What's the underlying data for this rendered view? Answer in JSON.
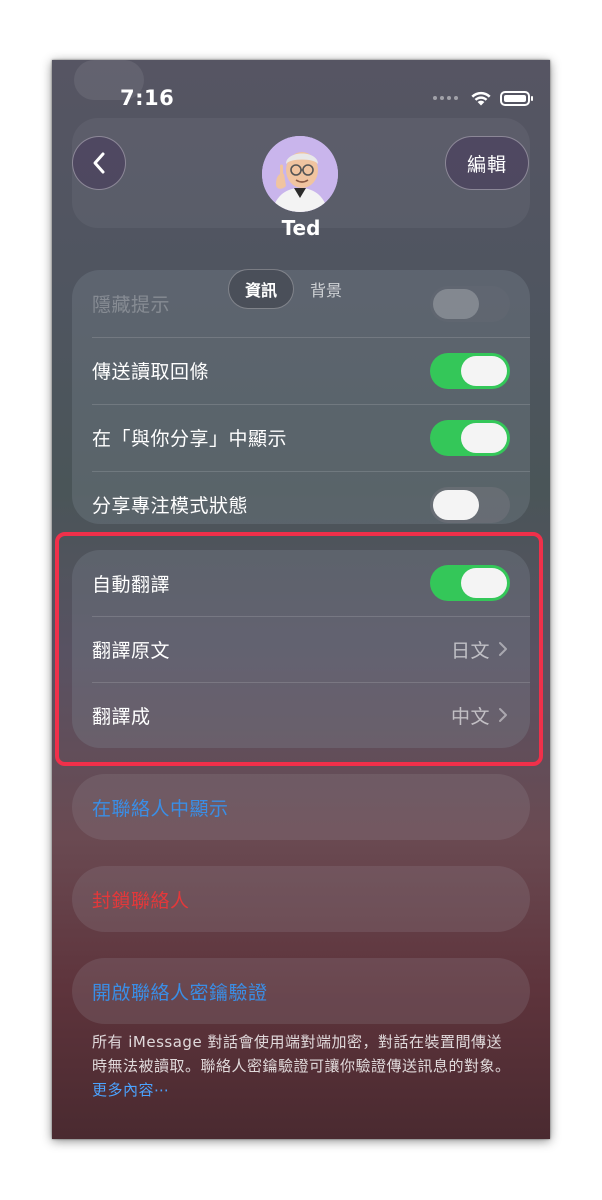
{
  "status_bar": {
    "time": "7:16"
  },
  "header": {
    "contact_name": "Ted",
    "edit_label": "編輯"
  },
  "tabs": [
    {
      "label": "資訊",
      "active": true
    },
    {
      "label": "背景",
      "active": false
    }
  ],
  "partial_row_behind_tabs": {
    "label": "隱藏提示",
    "toggle_on": false
  },
  "privacy_section": {
    "rows": [
      {
        "label": "傳送讀取回條",
        "toggle_on": true
      },
      {
        "label": "在「與你分享」中顯示",
        "toggle_on": true
      },
      {
        "label": "分享專注模式狀態",
        "toggle_on": false
      }
    ]
  },
  "translation_section": {
    "rows": [
      {
        "label": "自動翻譯",
        "toggle_on": true
      },
      {
        "label": "翻譯原文",
        "value": "日文"
      },
      {
        "label": "翻譯成",
        "value": "中文"
      }
    ]
  },
  "actions": {
    "show_in_contacts": "在聯絡人中顯示",
    "block_contact": "封鎖聯絡人",
    "key_verification": "開啟聯絡人密鑰驗證"
  },
  "footer": {
    "text": "所有 iMessage 對話會使用端對端加密，對話在裝置間傳送時無法被讀取。聯絡人密鑰驗證可讓你驗證傳送訊息的對象。",
    "link": "更多內容⋯"
  },
  "colors": {
    "toggle_on": "#34c759",
    "link_blue": "#3a8ee6",
    "destructive_red": "#e4383a",
    "highlight_border": "#f0304a"
  }
}
